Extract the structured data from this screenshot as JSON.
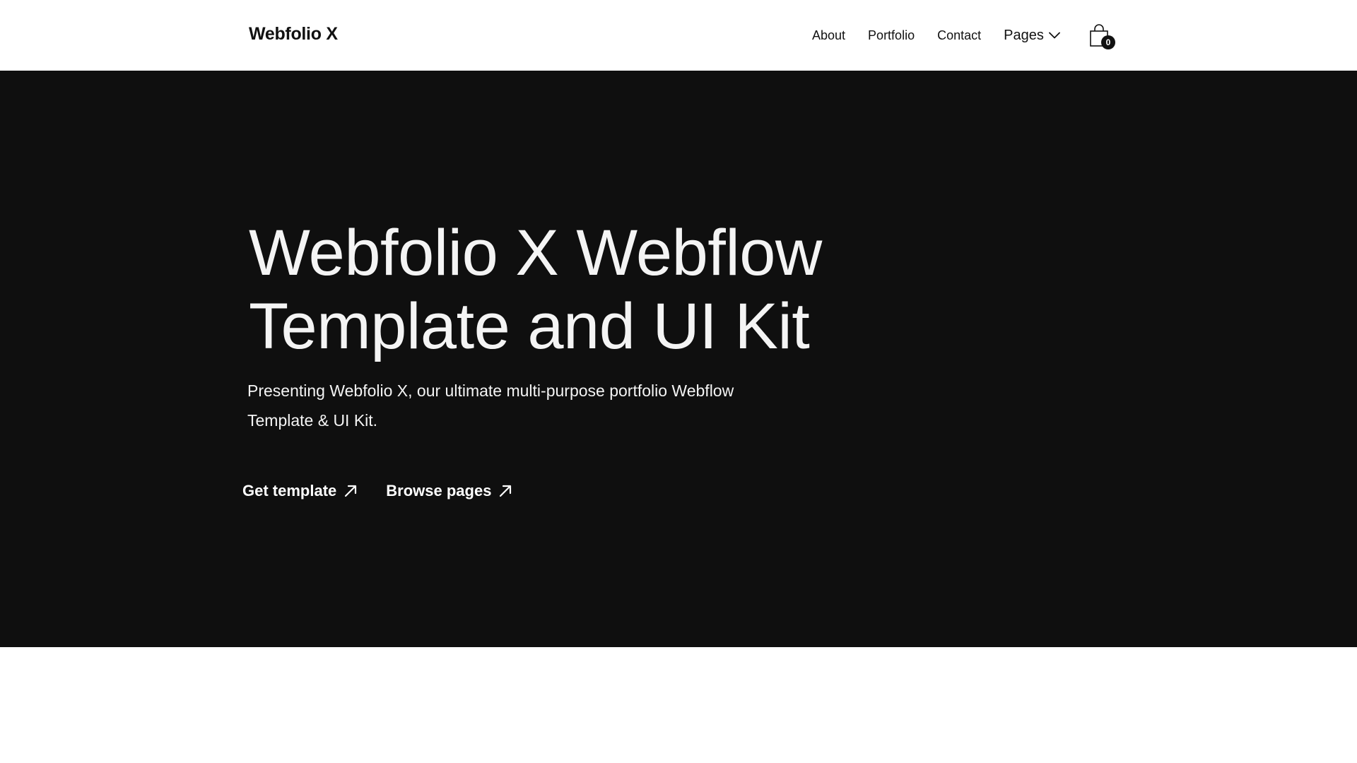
{
  "nav": {
    "brand": "Webfolio X",
    "links": [
      "About",
      "Portfolio",
      "Contact"
    ],
    "pages_label": "Pages",
    "cart_count": "0"
  },
  "hero": {
    "title": "Webfolio X Webflow Template and UI Kit",
    "subtitle": "Presenting Webfolio X, our ultimate multi-purpose portfolio Webflow Template & UI Kit.",
    "buttons": [
      "Get template",
      "Browse pages"
    ]
  },
  "colors": {
    "hero_background": "#0f0f0f",
    "hero_text": "#f4f4f4",
    "nav_background": "#ffffff",
    "nav_text": "#111111"
  },
  "icons": {
    "dropdown": "chevron-down-icon",
    "cart": "shopping-bag-icon",
    "button_arrow": "arrow-up-right-icon"
  }
}
